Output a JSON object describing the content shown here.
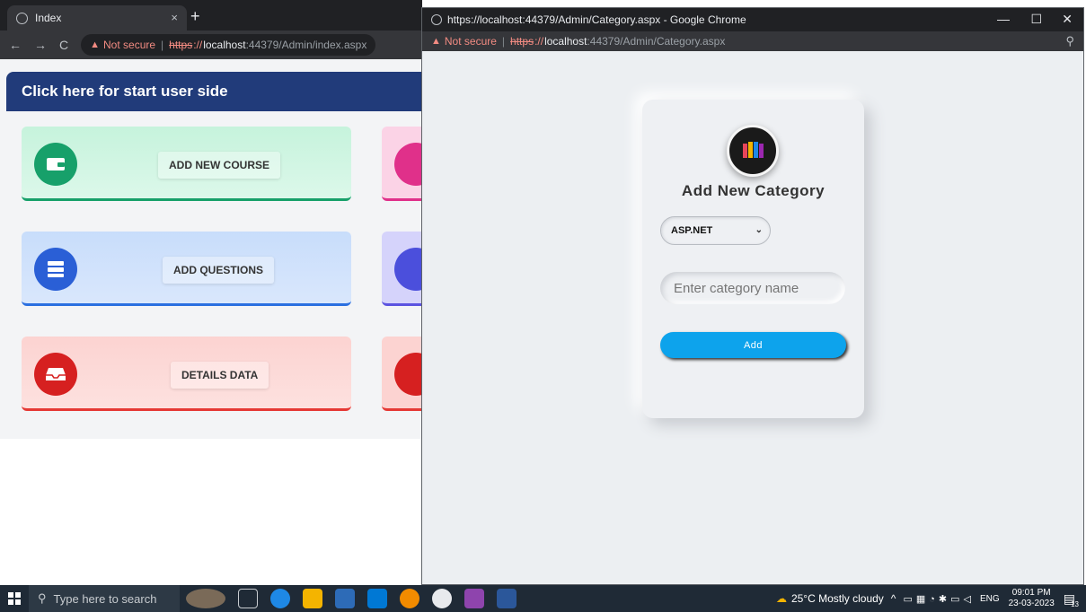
{
  "background_window": {
    "tab_title": "Index",
    "tab_close": "×",
    "new_tab": "+",
    "address": {
      "warning": "Not secure",
      "scheme": "https",
      "host": "localhost",
      "path": ":44379/Admin/index.aspx"
    },
    "banner_text": "Click here for start user side",
    "cards": [
      {
        "label": "ADD NEW COURSE",
        "color": "#17a06a",
        "bg": "#c6f3dc",
        "border": "#17a06a"
      },
      {
        "label": "ADD QUESTIONS",
        "color": "#2a5fd6",
        "bg": "#c8ddfb",
        "border": "#2a6fe0"
      },
      {
        "label": "DETAILS DATA",
        "color": "#d62020",
        "bg": "#fcd3d1",
        "border": "#e53935"
      }
    ]
  },
  "foreground_window": {
    "title": "https://localhost:44379/Admin/Category.aspx - Google Chrome",
    "controls": {
      "minimize": "—",
      "maximize": "☐",
      "close": "✕"
    },
    "address": {
      "warning": "Not secure",
      "scheme": "https",
      "host": "localhost",
      "path": ":44379/Admin/Category.aspx"
    },
    "form": {
      "title": "Add New Category",
      "select_value": "ASP.NET",
      "input_placeholder": "Enter category name",
      "add_button": "Add"
    }
  },
  "taskbar": {
    "search_placeholder": "Type here to search",
    "weather": "25°C Mostly cloudy",
    "language": "ENG",
    "time": "09:01 PM",
    "date": "23-03-2023",
    "notification_count": "13"
  }
}
